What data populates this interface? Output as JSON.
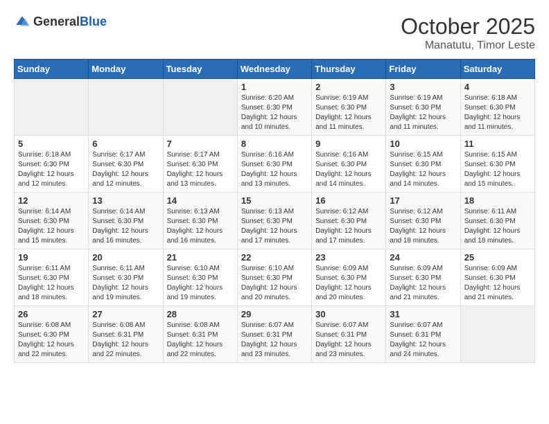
{
  "header": {
    "logo_general": "General",
    "logo_blue": "Blue",
    "month_year": "October 2025",
    "location": "Manatutu, Timor Leste"
  },
  "weekdays": [
    "Sunday",
    "Monday",
    "Tuesday",
    "Wednesday",
    "Thursday",
    "Friday",
    "Saturday"
  ],
  "weeks": [
    [
      {
        "day": "",
        "sunrise": "",
        "sunset": "",
        "daylight": ""
      },
      {
        "day": "",
        "sunrise": "",
        "sunset": "",
        "daylight": ""
      },
      {
        "day": "",
        "sunrise": "",
        "sunset": "",
        "daylight": ""
      },
      {
        "day": "1",
        "sunrise": "Sunrise: 6:20 AM",
        "sunset": "Sunset: 6:30 PM",
        "daylight": "Daylight: 12 hours and 10 minutes."
      },
      {
        "day": "2",
        "sunrise": "Sunrise: 6:19 AM",
        "sunset": "Sunset: 6:30 PM",
        "daylight": "Daylight: 12 hours and 11 minutes."
      },
      {
        "day": "3",
        "sunrise": "Sunrise: 6:19 AM",
        "sunset": "Sunset: 6:30 PM",
        "daylight": "Daylight: 12 hours and 11 minutes."
      },
      {
        "day": "4",
        "sunrise": "Sunrise: 6:18 AM",
        "sunset": "Sunset: 6:30 PM",
        "daylight": "Daylight: 12 hours and 11 minutes."
      }
    ],
    [
      {
        "day": "5",
        "sunrise": "Sunrise: 6:18 AM",
        "sunset": "Sunset: 6:30 PM",
        "daylight": "Daylight: 12 hours and 12 minutes."
      },
      {
        "day": "6",
        "sunrise": "Sunrise: 6:17 AM",
        "sunset": "Sunset: 6:30 PM",
        "daylight": "Daylight: 12 hours and 12 minutes."
      },
      {
        "day": "7",
        "sunrise": "Sunrise: 6:17 AM",
        "sunset": "Sunset: 6:30 PM",
        "daylight": "Daylight: 12 hours and 13 minutes."
      },
      {
        "day": "8",
        "sunrise": "Sunrise: 6:16 AM",
        "sunset": "Sunset: 6:30 PM",
        "daylight": "Daylight: 12 hours and 13 minutes."
      },
      {
        "day": "9",
        "sunrise": "Sunrise: 6:16 AM",
        "sunset": "Sunset: 6:30 PM",
        "daylight": "Daylight: 12 hours and 14 minutes."
      },
      {
        "day": "10",
        "sunrise": "Sunrise: 6:15 AM",
        "sunset": "Sunset: 6:30 PM",
        "daylight": "Daylight: 12 hours and 14 minutes."
      },
      {
        "day": "11",
        "sunrise": "Sunrise: 6:15 AM",
        "sunset": "Sunset: 6:30 PM",
        "daylight": "Daylight: 12 hours and 15 minutes."
      }
    ],
    [
      {
        "day": "12",
        "sunrise": "Sunrise: 6:14 AM",
        "sunset": "Sunset: 6:30 PM",
        "daylight": "Daylight: 12 hours and 15 minutes."
      },
      {
        "day": "13",
        "sunrise": "Sunrise: 6:14 AM",
        "sunset": "Sunset: 6:30 PM",
        "daylight": "Daylight: 12 hours and 16 minutes."
      },
      {
        "day": "14",
        "sunrise": "Sunrise: 6:13 AM",
        "sunset": "Sunset: 6:30 PM",
        "daylight": "Daylight: 12 hours and 16 minutes."
      },
      {
        "day": "15",
        "sunrise": "Sunrise: 6:13 AM",
        "sunset": "Sunset: 6:30 PM",
        "daylight": "Daylight: 12 hours and 17 minutes."
      },
      {
        "day": "16",
        "sunrise": "Sunrise: 6:12 AM",
        "sunset": "Sunset: 6:30 PM",
        "daylight": "Daylight: 12 hours and 17 minutes."
      },
      {
        "day": "17",
        "sunrise": "Sunrise: 6:12 AM",
        "sunset": "Sunset: 6:30 PM",
        "daylight": "Daylight: 12 hours and 18 minutes."
      },
      {
        "day": "18",
        "sunrise": "Sunrise: 6:11 AM",
        "sunset": "Sunset: 6:30 PM",
        "daylight": "Daylight: 12 hours and 18 minutes."
      }
    ],
    [
      {
        "day": "19",
        "sunrise": "Sunrise: 6:11 AM",
        "sunset": "Sunset: 6:30 PM",
        "daylight": "Daylight: 12 hours and 18 minutes."
      },
      {
        "day": "20",
        "sunrise": "Sunrise: 6:11 AM",
        "sunset": "Sunset: 6:30 PM",
        "daylight": "Daylight: 12 hours and 19 minutes."
      },
      {
        "day": "21",
        "sunrise": "Sunrise: 6:10 AM",
        "sunset": "Sunset: 6:30 PM",
        "daylight": "Daylight: 12 hours and 19 minutes."
      },
      {
        "day": "22",
        "sunrise": "Sunrise: 6:10 AM",
        "sunset": "Sunset: 6:30 PM",
        "daylight": "Daylight: 12 hours and 20 minutes."
      },
      {
        "day": "23",
        "sunrise": "Sunrise: 6:09 AM",
        "sunset": "Sunset: 6:30 PM",
        "daylight": "Daylight: 12 hours and 20 minutes."
      },
      {
        "day": "24",
        "sunrise": "Sunrise: 6:09 AM",
        "sunset": "Sunset: 6:30 PM",
        "daylight": "Daylight: 12 hours and 21 minutes."
      },
      {
        "day": "25",
        "sunrise": "Sunrise: 6:09 AM",
        "sunset": "Sunset: 6:30 PM",
        "daylight": "Daylight: 12 hours and 21 minutes."
      }
    ],
    [
      {
        "day": "26",
        "sunrise": "Sunrise: 6:08 AM",
        "sunset": "Sunset: 6:30 PM",
        "daylight": "Daylight: 12 hours and 22 minutes."
      },
      {
        "day": "27",
        "sunrise": "Sunrise: 6:08 AM",
        "sunset": "Sunset: 6:31 PM",
        "daylight": "Daylight: 12 hours and 22 minutes."
      },
      {
        "day": "28",
        "sunrise": "Sunrise: 6:08 AM",
        "sunset": "Sunset: 6:31 PM",
        "daylight": "Daylight: 12 hours and 22 minutes."
      },
      {
        "day": "29",
        "sunrise": "Sunrise: 6:07 AM",
        "sunset": "Sunset: 6:31 PM",
        "daylight": "Daylight: 12 hours and 23 minutes."
      },
      {
        "day": "30",
        "sunrise": "Sunrise: 6:07 AM",
        "sunset": "Sunset: 6:31 PM",
        "daylight": "Daylight: 12 hours and 23 minutes."
      },
      {
        "day": "31",
        "sunrise": "Sunrise: 6:07 AM",
        "sunset": "Sunset: 6:31 PM",
        "daylight": "Daylight: 12 hours and 24 minutes."
      },
      {
        "day": "",
        "sunrise": "",
        "sunset": "",
        "daylight": ""
      }
    ]
  ]
}
